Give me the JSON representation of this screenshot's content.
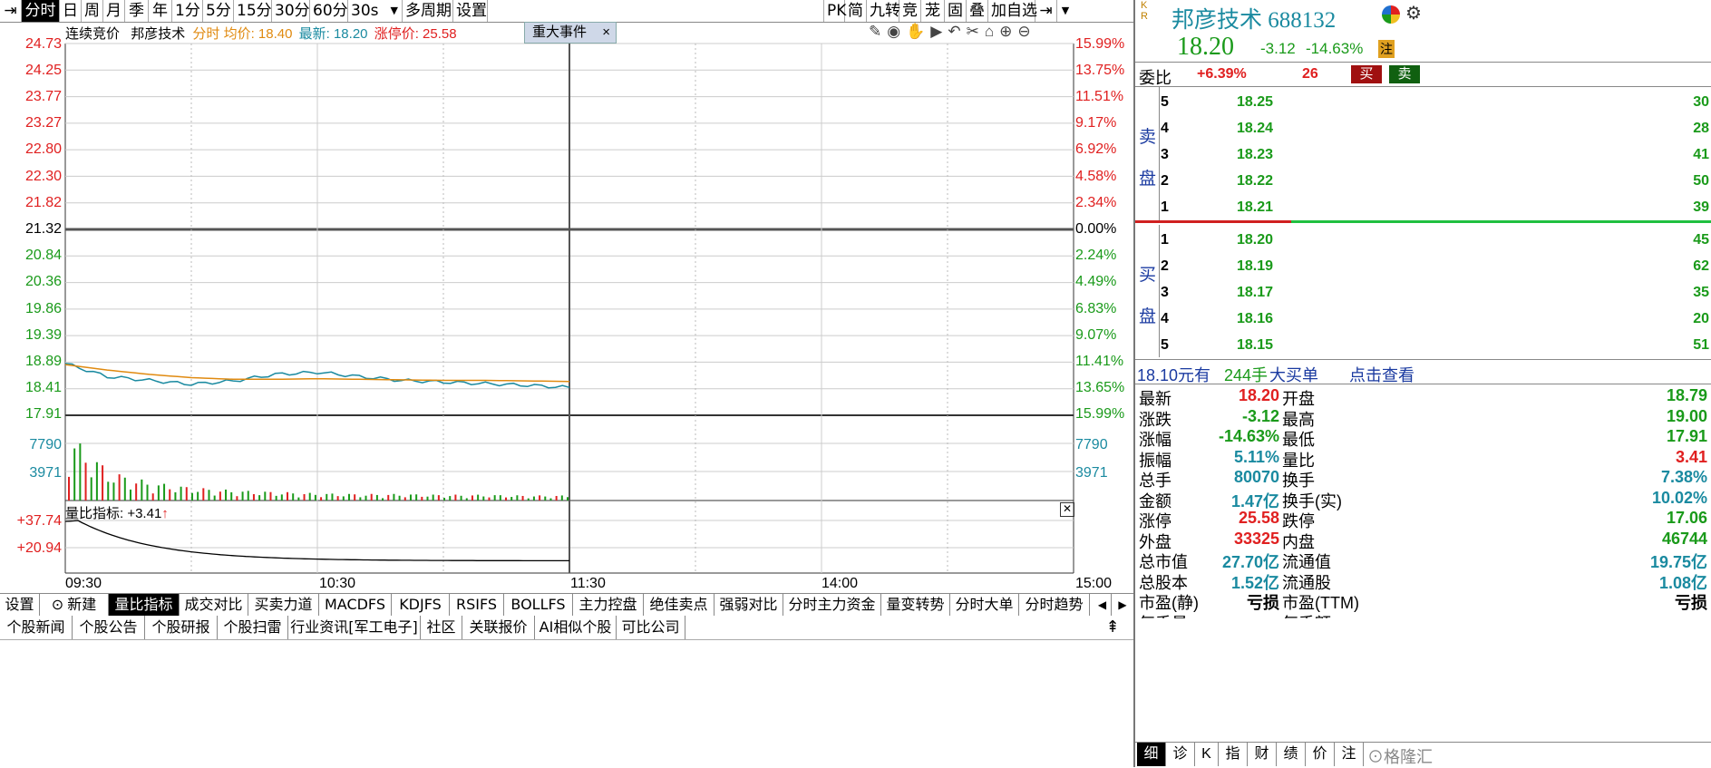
{
  "toolbar": {
    "items": [
      "分时",
      "日",
      "周",
      "月",
      "季",
      "年",
      "1分",
      "5分",
      "15分",
      "30分",
      "60分",
      "30s",
      "多周期",
      "设置"
    ],
    "right_items": [
      "PK",
      "简",
      "九转",
      "竞",
      "茏",
      "固",
      "叠",
      "加自选"
    ]
  },
  "chart": {
    "legend": {
      "auction": "连续竞价",
      "stock_name": "邦彦技术",
      "mode": "分时",
      "avg_label": "均价:",
      "avg_value": "18.40",
      "latest_label": "最新:",
      "latest_value": "18.20",
      "limit_label": "涨停价:",
      "limit_value": "25.58"
    },
    "event_tag": "重大事件",
    "event_close": "×",
    "price_ticks_up": [
      "24.73",
      "24.25",
      "23.77",
      "23.27",
      "22.80",
      "22.30",
      "21.82"
    ],
    "price_mid": "21.32",
    "price_ticks_down": [
      "20.84",
      "20.36",
      "19.86",
      "19.39",
      "18.89",
      "18.41",
      "17.91"
    ],
    "pct_ticks_up": [
      "15.99%",
      "13.75%",
      "11.51%",
      "9.17%",
      "6.92%",
      "4.58%",
      "2.34%"
    ],
    "pct_mid": "0.00%",
    "pct_ticks_down": [
      "2.24%",
      "4.49%",
      "6.83%",
      "9.07%",
      "11.41%",
      "13.65%",
      "15.99%"
    ],
    "vol_ticks": [
      "7790",
      "3971"
    ],
    "sub_indicator": "量比指标: +3.41",
    "sub_arrow": "↑",
    "sub_ticks": [
      "+37.74",
      "+20.94"
    ],
    "time_labels": [
      "09:30",
      "10:30",
      "11:30",
      "14:00",
      "15:00"
    ],
    "colors": {
      "up": "#e02020",
      "down": "#1a9a1a",
      "price_line": "#1a8aa0",
      "avg_line": "#e08a10"
    }
  },
  "chart_data": {
    "type": "line",
    "title": "邦彦技术 分时",
    "x": [
      "09:30",
      "09:40",
      "09:50",
      "10:00",
      "10:10",
      "10:20",
      "10:30",
      "10:40",
      "10:50",
      "11:00",
      "11:10",
      "11:20",
      "11:30"
    ],
    "series": [
      {
        "name": "price",
        "values": [
          18.86,
          18.62,
          18.55,
          18.48,
          18.54,
          18.66,
          18.7,
          18.62,
          18.55,
          18.52,
          18.49,
          18.46,
          18.42
        ]
      },
      {
        "name": "average",
        "values": [
          18.84,
          18.74,
          18.66,
          18.6,
          18.57,
          18.57,
          18.58,
          18.57,
          18.56,
          18.55,
          18.55,
          18.54,
          18.53
        ]
      }
    ],
    "ylim": [
      17.91,
      24.73
    ],
    "volume": [
      9200,
      3971,
      2500,
      1800,
      1400,
      1200,
      1000,
      900,
      900,
      800,
      800,
      700,
      700
    ],
    "volume_ylim": [
      0,
      11600
    ]
  },
  "quote": {
    "name": "邦彦技术",
    "code": "688132",
    "price": "18.20",
    "change": "-3.12",
    "change_pct": "-14.63%",
    "note_badge": "注",
    "webi_label": "委比",
    "webi_value": "+6.39%",
    "webi_diff": "26",
    "buy_btn": "买",
    "sell_btn": "卖"
  },
  "book": {
    "sell_label": [
      "卖",
      "盘"
    ],
    "buy_label": [
      "买",
      "盘"
    ],
    "asks": [
      {
        "lvl": "5",
        "price": "18.25",
        "vol": "30"
      },
      {
        "lvl": "4",
        "price": "18.24",
        "vol": "28"
      },
      {
        "lvl": "3",
        "price": "18.23",
        "vol": "41"
      },
      {
        "lvl": "2",
        "price": "18.22",
        "vol": "50"
      },
      {
        "lvl": "1",
        "price": "18.21",
        "vol": "39"
      }
    ],
    "bids": [
      {
        "lvl": "1",
        "price": "18.20",
        "vol": "45"
      },
      {
        "lvl": "2",
        "price": "18.19",
        "vol": "62"
      },
      {
        "lvl": "3",
        "price": "18.17",
        "vol": "35"
      },
      {
        "lvl": "4",
        "price": "18.16",
        "vol": "20"
      },
      {
        "lvl": "5",
        "price": "18.15",
        "vol": "51"
      }
    ]
  },
  "big_order": {
    "price_text": "18.10元有",
    "lots": "244手",
    "label": "大买单",
    "link": "点击查看"
  },
  "stats": [
    {
      "l1": "最新",
      "v1": "18.20",
      "c1": "red",
      "l2": "开盘",
      "v2": "18.79",
      "c2": "green"
    },
    {
      "l1": "涨跌",
      "v1": "-3.12",
      "c1": "green",
      "l2": "最高",
      "v2": "19.00",
      "c2": "green"
    },
    {
      "l1": "涨幅",
      "v1": "-14.63%",
      "c1": "green",
      "l2": "最低",
      "v2": "17.91",
      "c2": "green"
    },
    {
      "l1": "振幅",
      "v1": "5.11%",
      "c1": "teal",
      "l2": "量比",
      "v2": "3.41",
      "c2": "red"
    },
    {
      "l1": "总手",
      "v1": "80070",
      "c1": "teal",
      "l2": "换手",
      "v2": "7.38%",
      "c2": "teal"
    },
    {
      "l1": "金额",
      "v1": "1.47亿",
      "c1": "teal",
      "l2": "换手(实)",
      "v2": "10.02%",
      "c2": "teal"
    },
    {
      "l1": "涨停",
      "v1": "25.58",
      "c1": "red",
      "l2": "跌停",
      "v2": "17.06",
      "c2": "green"
    },
    {
      "l1": "外盘",
      "v1": "33325",
      "c1": "red",
      "l2": "内盘",
      "v2": "46744",
      "c2": "green"
    },
    {
      "l1": "总市值",
      "v1": "27.70亿",
      "c1": "teal",
      "l2": "流通值",
      "v2": "19.75亿",
      "c2": "teal"
    },
    {
      "l1": "总股本",
      "v1": "1.52亿",
      "c1": "teal",
      "l2": "流通股",
      "v2": "1.08亿",
      "c2": "teal"
    },
    {
      "l1": "市盈(静)",
      "v1": "亏损",
      "c1": "black",
      "l2": "市盈(TTM)",
      "v2": "亏损",
      "c2": "black"
    }
  ],
  "stats_cut": {
    "l1": "每手量",
    "l2": "每手额"
  },
  "right_tabs": [
    "细",
    "诊",
    "K",
    "指",
    "财",
    "绩",
    "价",
    "注"
  ],
  "watermark": "格隆汇",
  "bottom_tabs": [
    "设置",
    "新建",
    "量比指标",
    "成交对比",
    "买卖力道",
    "MACDFS",
    "KDJFS",
    "RSIFS",
    "BOLLFS",
    "主力控盘",
    "绝佳卖点",
    "强弱对比",
    "分时主力资金",
    "量变转势",
    "分时大单",
    "分时趋势"
  ],
  "news_tabs": [
    "个股新闻",
    "个股公告",
    "个股研报",
    "个股扫雷",
    "行业资讯[军工电子]",
    "社区",
    "关联报价",
    "AI相似个股",
    "可比公司"
  ]
}
